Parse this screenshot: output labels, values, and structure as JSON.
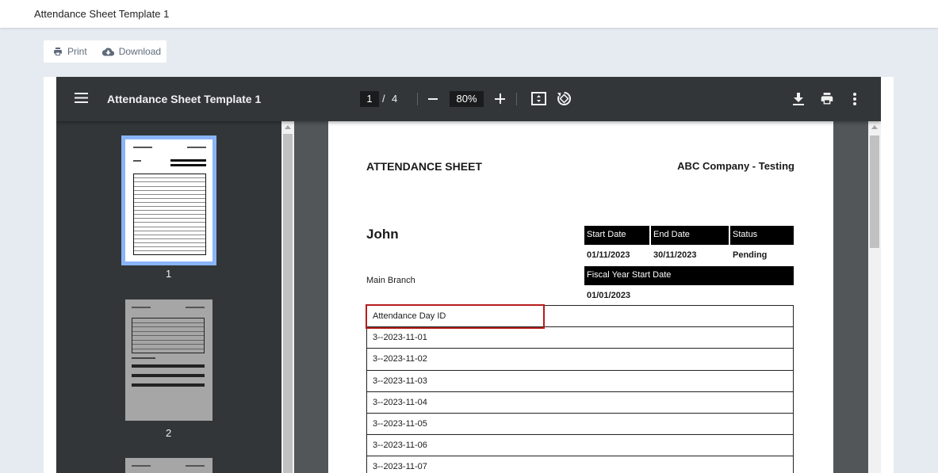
{
  "app": {
    "title": "Attendance Sheet Template 1"
  },
  "actions": {
    "print_label": "Print",
    "download_label": "Download"
  },
  "viewer": {
    "doc_title": "Attendance Sheet Template 1",
    "current_page": "1",
    "page_separator": "/",
    "total_pages": "4",
    "zoom": "80%",
    "icons": [
      "menu-icon",
      "zoom-out-icon",
      "zoom-in-icon",
      "fit-page-icon",
      "rotate-icon",
      "download-icon",
      "print-icon",
      "more-vert-icon"
    ]
  },
  "thumbnails": [
    {
      "label": "1",
      "selected": true
    },
    {
      "label": "2",
      "selected": false
    }
  ],
  "document": {
    "sheet_title": "ATTENDANCE SHEET",
    "company": "ABC Company - Testing",
    "employee_name": "John",
    "branch": "Main Branch",
    "period_headers": [
      "Start Date",
      "End Date",
      "Status"
    ],
    "period_values": [
      "01/11/2023",
      "30/11/2023",
      "Pending"
    ],
    "fiscal_header": "Fiscal Year Start Date",
    "fiscal_value": "01/01/2023",
    "table_header": "Attendance Day ID",
    "rows": [
      "3--2023-11-01",
      "3--2023-11-02",
      "3--2023-11-03",
      "3--2023-11-04",
      "3--2023-11-05",
      "3--2023-11-06",
      "3--2023-11-07"
    ]
  },
  "colors": {
    "toolbar": "#323639",
    "viewer_bg": "#525659",
    "selection": "#8ab4f8",
    "highlight": "#b71c1c"
  }
}
